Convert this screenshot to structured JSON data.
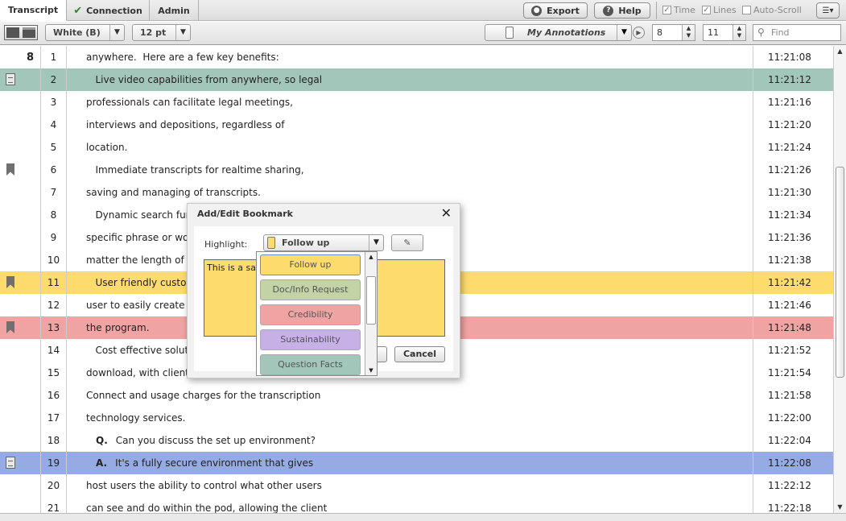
{
  "tabs": [
    {
      "label": "Transcript"
    },
    {
      "label": "Connection"
    },
    {
      "label": "Admin"
    }
  ],
  "topbar": {
    "export_label": "Export",
    "help_label": "Help",
    "time_label": "Time",
    "lines_label": "Lines",
    "autoscroll_label": "Auto-Scroll"
  },
  "toolbar": {
    "theme_value": "White (B)",
    "font_size_value": "12 pt",
    "annotation_set": "My Annotations",
    "spinner1_value": "8",
    "spinner2_value": "11",
    "find_placeholder": "Find"
  },
  "transcript": {
    "rows": [
      {
        "page": "8",
        "line": "1",
        "text": "anywhere.  Here are a few key benefits:",
        "qa": "",
        "time": "11:21:08",
        "highlight": "",
        "marker": ""
      },
      {
        "page": "",
        "line": "2",
        "text": "   Live video capabilities from anywhere, so legal",
        "qa": "",
        "time": "11:21:12",
        "highlight": "#a3c6bb",
        "marker": "note"
      },
      {
        "page": "",
        "line": "3",
        "text": "professionals can facilitate legal meetings,",
        "qa": "",
        "time": "11:21:16",
        "highlight": "",
        "marker": ""
      },
      {
        "page": "",
        "line": "4",
        "text": "interviews and depositions, regardless of",
        "qa": "",
        "time": "11:21:20",
        "highlight": "",
        "marker": ""
      },
      {
        "page": "",
        "line": "5",
        "text": "location.",
        "qa": "",
        "time": "11:21:24",
        "highlight": "",
        "marker": ""
      },
      {
        "page": "",
        "line": "6",
        "text": "   Immediate transcripts for realtime sharing,",
        "qa": "",
        "time": "11:21:26",
        "highlight": "",
        "marker": "bookmark"
      },
      {
        "page": "",
        "line": "7",
        "text": "saving and managing of transcripts.",
        "qa": "",
        "time": "11:21:30",
        "highlight": "",
        "marker": ""
      },
      {
        "page": "",
        "line": "8",
        "text": "   Dynamic search func",
        "qa": "",
        "time": "11:21:34",
        "highlight": "",
        "marker": ""
      },
      {
        "page": "",
        "line": "9",
        "text": "specific phrase or word",
        "qa": "",
        "time": "11:21:36",
        "highlight": "",
        "marker": ""
      },
      {
        "page": "",
        "line": "10",
        "text": "matter the length of th",
        "qa": "",
        "time": "11:21:38",
        "highlight": "",
        "marker": ""
      },
      {
        "page": "",
        "line": "11",
        "text": "   User friendly customi",
        "qa": "",
        "time": "11:21:42",
        "highlight": "#fddb6d",
        "marker": "bookmark"
      },
      {
        "page": "",
        "line": "12",
        "text": "user to easily create an",
        "qa": "",
        "time": "11:21:46",
        "highlight": "",
        "marker": ""
      },
      {
        "page": "",
        "line": "13",
        "text": "the program.",
        "qa": "",
        "time": "11:21:48",
        "highlight": "#f0a3a3",
        "marker": "bookmark"
      },
      {
        "page": "",
        "line": "14",
        "text": "   Cost effective solutio",
        "qa": "",
        "time": "11:21:52",
        "highlight": "",
        "marker": ""
      },
      {
        "page": "",
        "line": "15",
        "text": "download, with clients",
        "qa": "",
        "time": "11:21:54",
        "highlight": "",
        "marker": ""
      },
      {
        "page": "",
        "line": "16",
        "text": "Connect and usage charges for the transcription",
        "qa": "",
        "time": "11:21:58",
        "highlight": "",
        "marker": ""
      },
      {
        "page": "",
        "line": "17",
        "text": "technology services.",
        "qa": "",
        "time": "11:22:00",
        "highlight": "",
        "marker": ""
      },
      {
        "page": "",
        "line": "18",
        "text": "Can you discuss the set up environment?",
        "qa": "Q.",
        "time": "11:22:04",
        "highlight": "",
        "marker": ""
      },
      {
        "page": "",
        "line": "19",
        "text": "It's a fully secure environment that gives",
        "qa": "A.",
        "time": "11:22:08",
        "highlight": "#96abe3",
        "marker": "note"
      },
      {
        "page": "",
        "line": "20",
        "text": "host users the ability to control what other users",
        "qa": "",
        "time": "11:22:12",
        "highlight": "",
        "marker": ""
      },
      {
        "page": "",
        "line": "21",
        "text": "can see and do within the pod, allowing the client",
        "qa": "",
        "time": "11:22:18",
        "highlight": "",
        "marker": ""
      }
    ]
  },
  "dialog": {
    "title": "Add/Edit Bookmark",
    "highlight_label": "Highlight:",
    "highlight_value": "Follow up",
    "note_text": "This is a sa",
    "cancel_label": "Cancel"
  },
  "dropdown": {
    "items": [
      {
        "label": "Follow up",
        "color": "#fddb6d"
      },
      {
        "label": "Doc/Info Request",
        "color": "#c3d3a6"
      },
      {
        "label": "Credibility",
        "color": "#f0a3a3"
      },
      {
        "label": "Sustainability",
        "color": "#c7b0e6"
      },
      {
        "label": "Question Facts",
        "color": "#a3c6bb"
      }
    ]
  }
}
